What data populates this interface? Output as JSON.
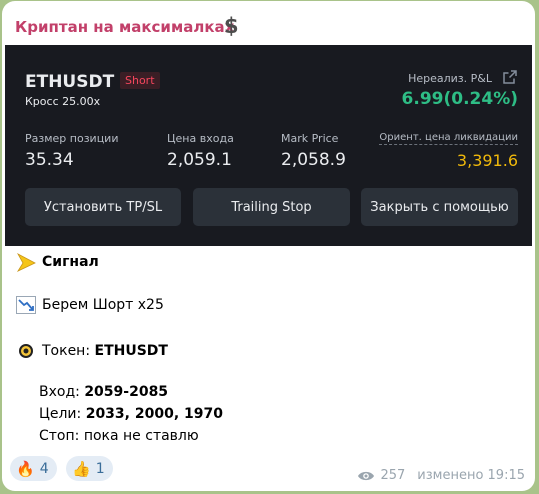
{
  "channel": {
    "name": "Криптан на максималках",
    "name_emoji": "$"
  },
  "card": {
    "symbol": "ETHUSDT",
    "side": "Short",
    "margin_mode": "Кросс 25.00x",
    "pnl_label": "Нереализ. P&L",
    "pnl_value": "6.99(0.24%)",
    "position_size_label": "Размер позиции",
    "position_size": "35.34",
    "entry_price_label": "Цена входа",
    "entry_price": "2,059.1",
    "mark_price_label": "Mark Price",
    "mark_price": "2,058.9",
    "liq_label": "Ориент. цена ликвидации",
    "liq_price": "3,391.6",
    "buttons": {
      "tpsl": "Установить TP/SL",
      "trailing": "Trailing Stop",
      "close": "Закрыть с помощью"
    },
    "colors": {
      "background": "#181a20",
      "profit": "#2ebd85",
      "short": "#f6465d",
      "liquidation": "#f0b90b"
    }
  },
  "message": {
    "signal_emoji": "pointing-triangle-icon",
    "signal": "Сигнал",
    "direction_emoji": "chart-decreasing-icon",
    "direction": "Берем Шорт x25",
    "token_emoji": "coin-icon",
    "token_label": "Токен: ",
    "token": "ETHUSDT",
    "entry_label": "Вход: ",
    "entry": "2059-2085",
    "targets_label": "Цели: ",
    "targets": "2033, 2000, 1970",
    "stop_label": "Стоп: ",
    "stop": "пока не ставлю"
  },
  "reactions": [
    {
      "emoji": "🔥",
      "count": "4"
    },
    {
      "emoji": "👍",
      "count": "1"
    }
  ],
  "meta": {
    "views": "257",
    "edited": "изменено 19:15"
  }
}
